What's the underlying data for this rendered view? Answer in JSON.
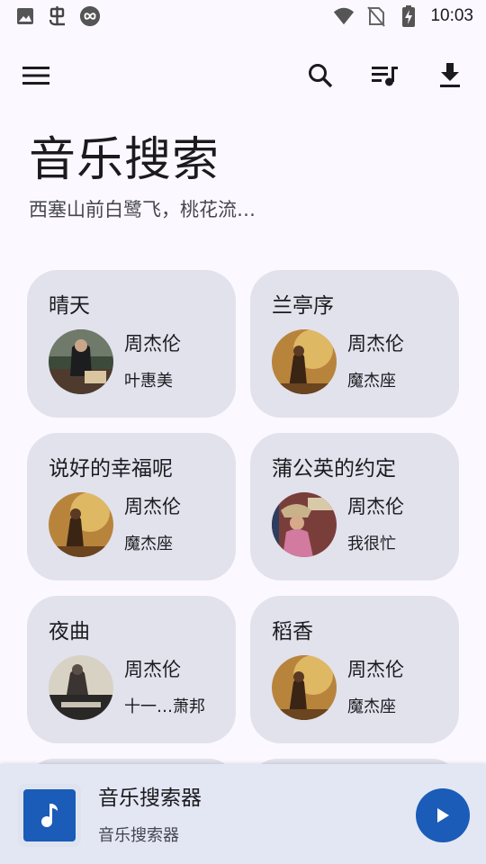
{
  "status_bar": {
    "time": "10:03",
    "left_icons": [
      "image-icon",
      "bug-icon",
      "infinity-icon"
    ],
    "right_icons": [
      "wifi-icon",
      "no-sim-icon",
      "battery-charging-icon"
    ]
  },
  "app_bar": {
    "icons": [
      "menu-icon",
      "search-icon",
      "queue-music-icon",
      "download-icon"
    ]
  },
  "header": {
    "title": "音乐搜索",
    "subtitle": "西塞山前白鹭飞，桃花流…"
  },
  "songs": [
    {
      "title": "晴天",
      "artist": "周杰伦",
      "album": "叶惠美",
      "cover": "cover-yehuimei"
    },
    {
      "title": "兰亭序",
      "artist": "周杰伦",
      "album": "魔杰座",
      "cover": "cover-mojiezuo"
    },
    {
      "title": "说好的幸福呢",
      "artist": "周杰伦",
      "album": "魔杰座",
      "cover": "cover-mojiezuo"
    },
    {
      "title": "蒲公英的约定",
      "artist": "周杰伦",
      "album": "我很忙",
      "cover": "cover-wohenmang"
    },
    {
      "title": "夜曲",
      "artist": "周杰伦",
      "album": "十一…萧邦",
      "cover": "cover-november-chopin"
    },
    {
      "title": "稻香",
      "artist": "周杰伦",
      "album": "魔杰座",
      "cover": "cover-mojiezuo"
    }
  ],
  "player": {
    "title": "音乐搜索器",
    "subtitle": "音乐搜索器",
    "art_icon": "music-note-icon",
    "play_icon": "play-icon"
  },
  "colors": {
    "background": "#fcf8ff",
    "card": "#e1e2ec",
    "player_bar": "#e3e7f4",
    "accent": "#1a5cb8"
  }
}
